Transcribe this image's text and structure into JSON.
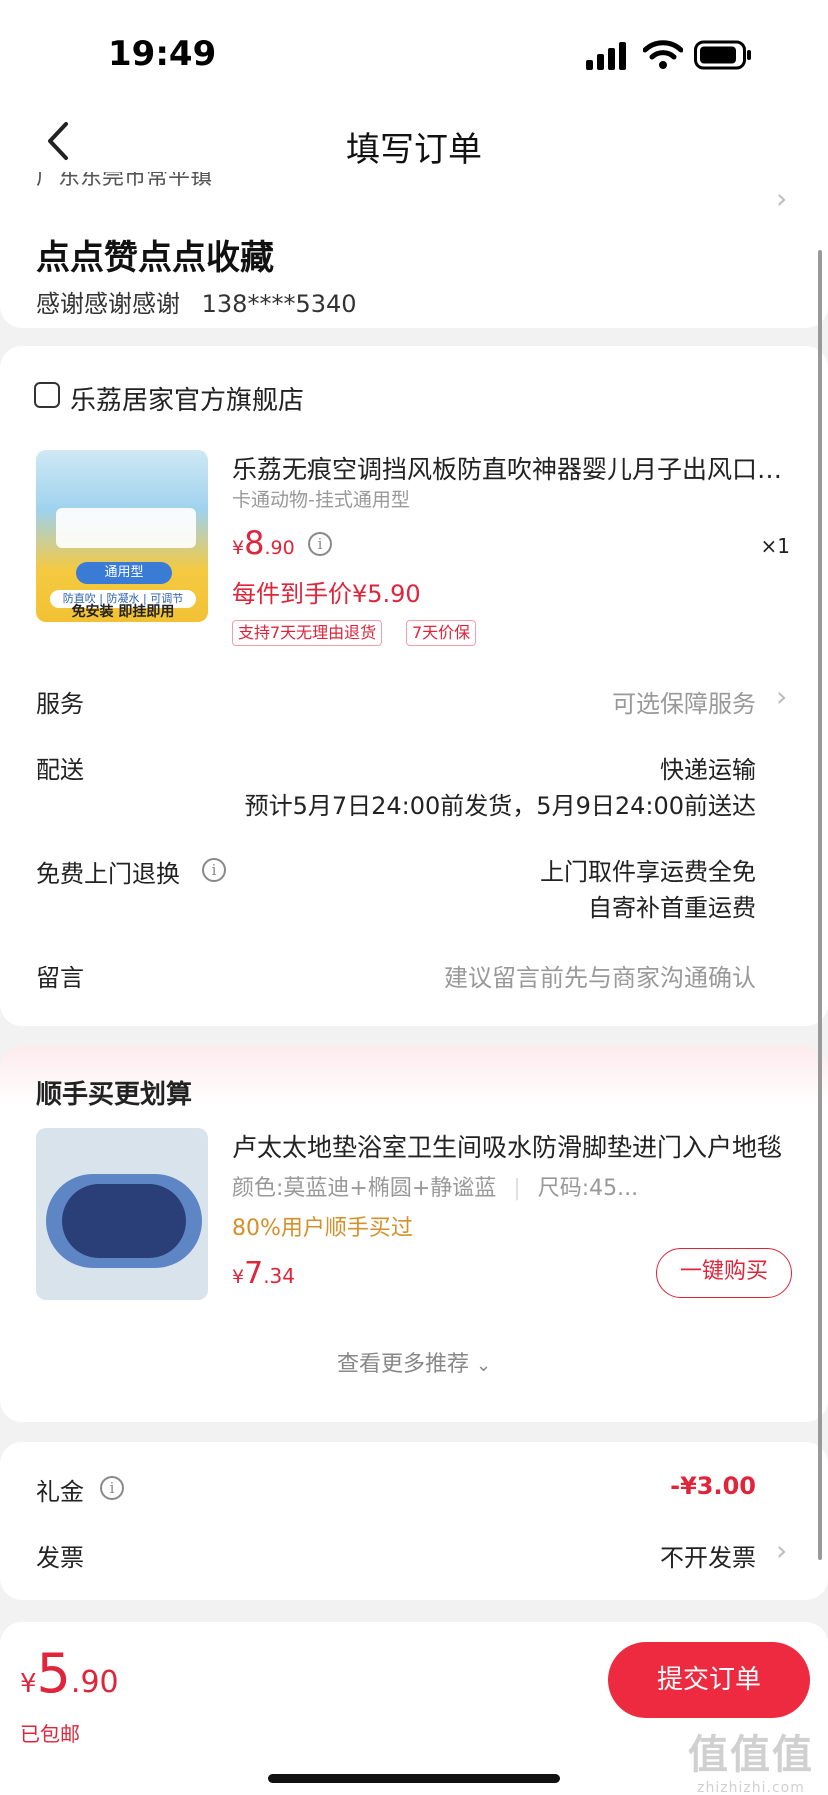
{
  "status": {
    "time": "19:49"
  },
  "nav": {
    "title": "填写订单"
  },
  "address": {
    "clipped_line": "广东东莞市常平镇",
    "name": "点点赞点点收藏",
    "contact_name": "感谢感谢感谢",
    "phone": "138****5340"
  },
  "order": {
    "store_name": "乐荔居家官方旗舰店",
    "product": {
      "title": "乐荔无痕空调挡风板防直吹神器婴儿月子出风口挡板",
      "spec": "卡通动物-挂式通用型",
      "price_symbol": "¥",
      "price_int": "8",
      "price_dec": ".90",
      "quantity": "×1",
      "unit_price": "每件到手价¥5.90",
      "tags": [
        "支持7天无理由退货",
        "7天价保"
      ],
      "image_text": [
        "通用型",
        "防直吹 | 防凝水 | 可调节",
        "免安装 即挂即用"
      ]
    },
    "rows": {
      "service_label": "服务",
      "service_value": "可选保障服务",
      "delivery_label": "配送",
      "delivery_method": "快递运输",
      "delivery_eta": "预计5月7日24:00前发货，5月9日24:00前送达",
      "return_label": "免费上门退换",
      "return_line1": "上门取件享运费全免",
      "return_line2": "自寄补首重运费",
      "message_label": "留言",
      "message_placeholder": "建议留言前先与商家沟通确认"
    }
  },
  "recommend": {
    "title": "顺手买更划算",
    "item": {
      "name": "卢太太地垫浴室卫生间吸水防滑脚垫进门入户地毯",
      "spec": "颜色:莫蓝迪+椭圆+静谧蓝",
      "size": "尺码:45...",
      "bought": "80%用户顺手买过",
      "price_symbol": "¥",
      "price_int": "7",
      "price_dec": ".34",
      "button": "一键购买"
    },
    "more": "查看更多推荐"
  },
  "fees": {
    "gift_label": "礼金",
    "gift_value": "-¥3.00",
    "invoice_label": "发票",
    "invoice_value": "不开发票"
  },
  "bottom": {
    "total_symbol": "¥",
    "total_int": "5",
    "total_dec": ".90",
    "shipping": "已包邮",
    "submit": "提交订单",
    "watermark": "值值值",
    "watermark_url": "zhizhizhi.com"
  },
  "colors": {
    "accent": "#e0243a",
    "submit_bg": "#ee2a40",
    "bought": "#d4902a"
  }
}
